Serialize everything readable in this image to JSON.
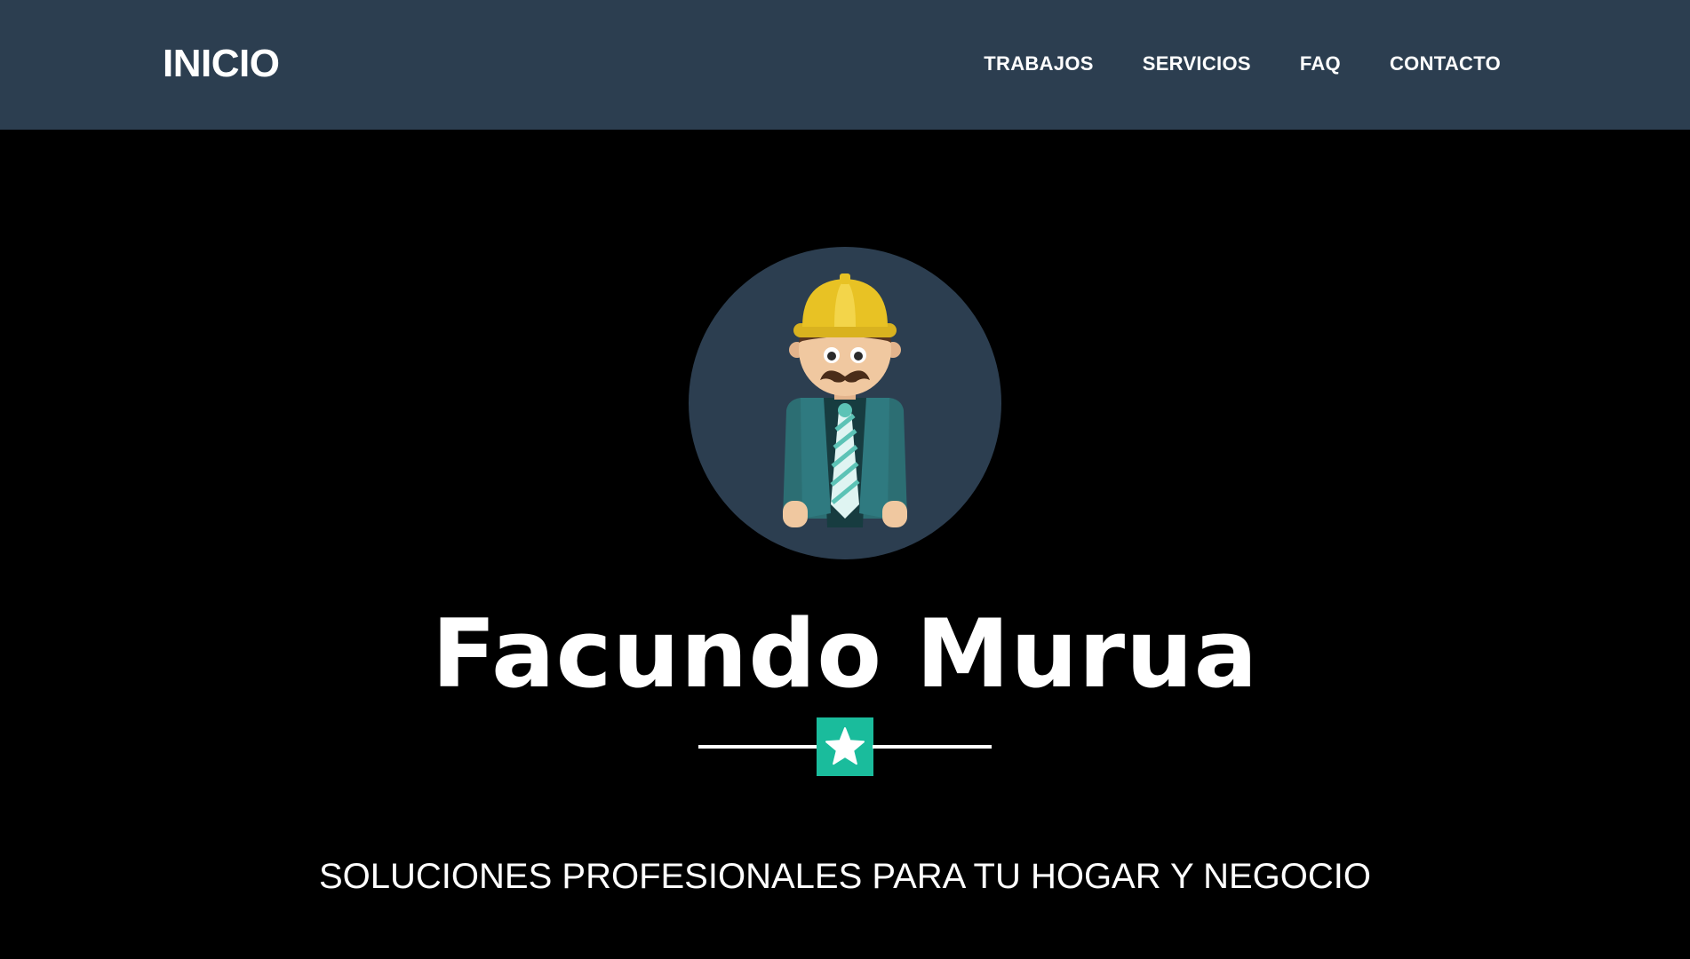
{
  "navbar": {
    "brand": "INICIO",
    "links": [
      "TRABAJOS",
      "SERVICIOS",
      "FAQ",
      "CONTACTO"
    ]
  },
  "hero": {
    "avatar_icon": "construction-worker-icon",
    "name": "Facundo Murua",
    "divider_icon": "star-icon",
    "tagline": "SOLUCIONES PROFESIONALES PARA TU HOGAR Y NEGOCIO"
  },
  "colors": {
    "navbar_background": "#2c3e50",
    "page_background": "#000000",
    "accent": "#1abc9c",
    "text": "#ffffff",
    "helmet": "#e8c224",
    "jacket": "#2c6e73"
  }
}
